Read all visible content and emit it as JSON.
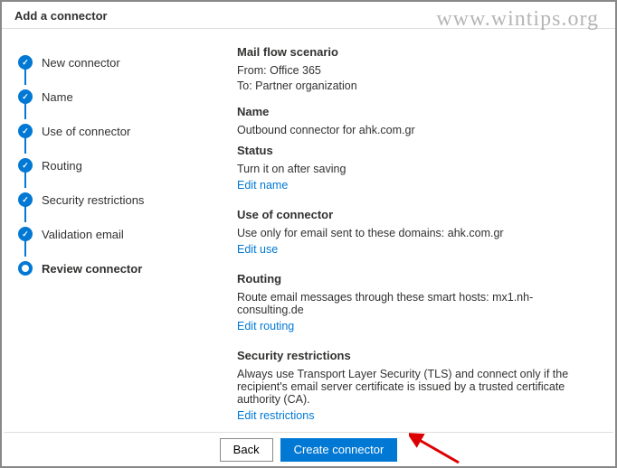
{
  "header": {
    "title": "Add a connector"
  },
  "watermark": "www.wintips.org",
  "sidebar": {
    "steps": [
      {
        "label": "New connector",
        "state": "completed"
      },
      {
        "label": "Name",
        "state": "completed"
      },
      {
        "label": "Use of connector",
        "state": "completed"
      },
      {
        "label": "Routing",
        "state": "completed"
      },
      {
        "label": "Security restrictions",
        "state": "completed"
      },
      {
        "label": "Validation email",
        "state": "completed"
      },
      {
        "label": "Review connector",
        "state": "current"
      }
    ]
  },
  "main": {
    "mail_flow": {
      "title": "Mail flow scenario",
      "from": "From: Office 365",
      "to": "To: Partner organization"
    },
    "name": {
      "title": "Name",
      "value": "Outbound connector for ahk.com.gr"
    },
    "status": {
      "title": "Status",
      "value": "Turn it on after saving",
      "edit": "Edit name"
    },
    "use": {
      "title": "Use of connector",
      "value": "Use only for email sent to these domains: ahk.com.gr",
      "edit": "Edit use"
    },
    "routing": {
      "title": "Routing",
      "value": "Route email messages through these smart hosts: mx1.nh-consulting.de",
      "edit": "Edit routing"
    },
    "security": {
      "title": "Security restrictions",
      "value": "Always use Transport Layer Security (TLS) and connect only if the recipient's email server certificate is issued by a trusted certificate authority (CA).",
      "edit": "Edit restrictions"
    }
  },
  "footer": {
    "back": "Back",
    "create": "Create connector"
  }
}
